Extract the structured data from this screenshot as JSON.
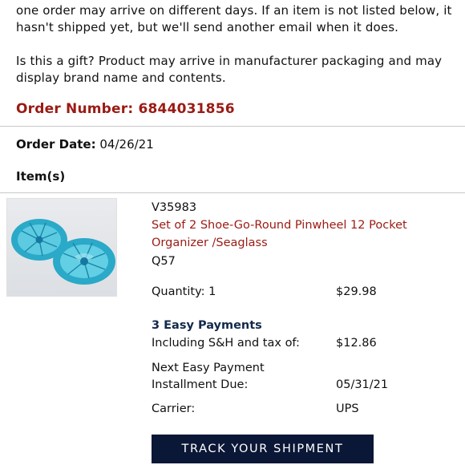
{
  "intro": {
    "line1": "one order may arrive on different days. If an item is not listed below, it hasn't shipped yet, but we'll send another email when it does.",
    "line2": "Is this a gift? Product may arrive in manufacturer packaging and may display brand name and contents."
  },
  "order": {
    "number": "Order Number: 6844031856",
    "date_label": "Order Date:",
    "date_value": "04/26/21",
    "items_heading": "Item(s)"
  },
  "item": {
    "sku": "V35983",
    "title": "Set of 2 Shoe-Go-Round Pinwheel 12 Pocket Organizer /Seaglass",
    "code": "Q57",
    "quantity_label": "Quantity: 1",
    "price": "$29.98",
    "payments_heading": "3 Easy Payments",
    "including_label": "Including S&H and tax of:",
    "including_value": "$12.86",
    "next_payment_label": "Next Easy Payment",
    "installment_label": "Installment Due:",
    "installment_value": "05/31/21",
    "carrier_label": "Carrier:",
    "carrier_value": "UPS",
    "image_icon": "product-photo-seaglass-organizer"
  },
  "track_button": "TRACK YOUR SHIPMENT",
  "colors": {
    "order_number": "#9a1b14",
    "payments_heading": "#13294b",
    "button_bg": "#0b1736"
  }
}
